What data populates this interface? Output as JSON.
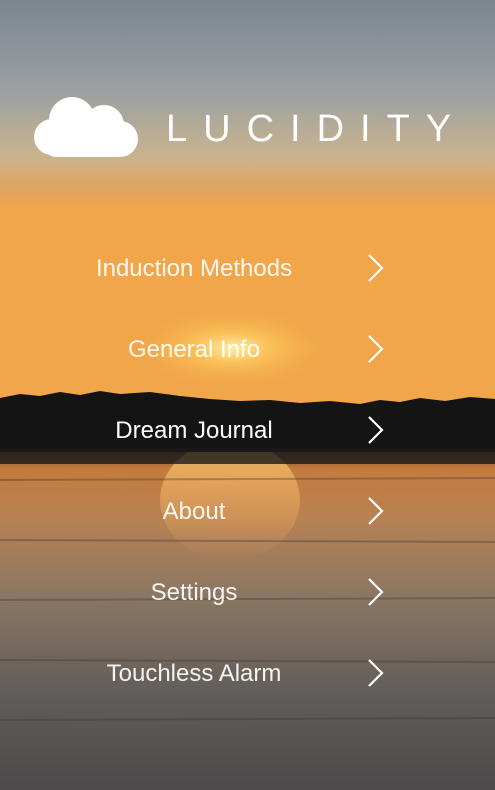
{
  "app": {
    "title": "LUCIDITY",
    "logo_icon": "cloud-icon"
  },
  "menu": {
    "items": [
      {
        "label": "Induction Methods",
        "icon": "chevron-right-icon"
      },
      {
        "label": "General Info",
        "icon": "chevron-right-icon"
      },
      {
        "label": "Dream Journal",
        "icon": "chevron-right-icon"
      },
      {
        "label": "About",
        "icon": "chevron-right-icon"
      },
      {
        "label": "Settings",
        "icon": "chevron-right-icon"
      },
      {
        "label": "Touchless Alarm",
        "icon": "chevron-right-icon"
      }
    ]
  },
  "colors": {
    "text": "#ffffff",
    "sky_top": "#7d8791",
    "sky_glow": "#f2a64c",
    "treeline": "#141414",
    "water": "#5a5654"
  }
}
